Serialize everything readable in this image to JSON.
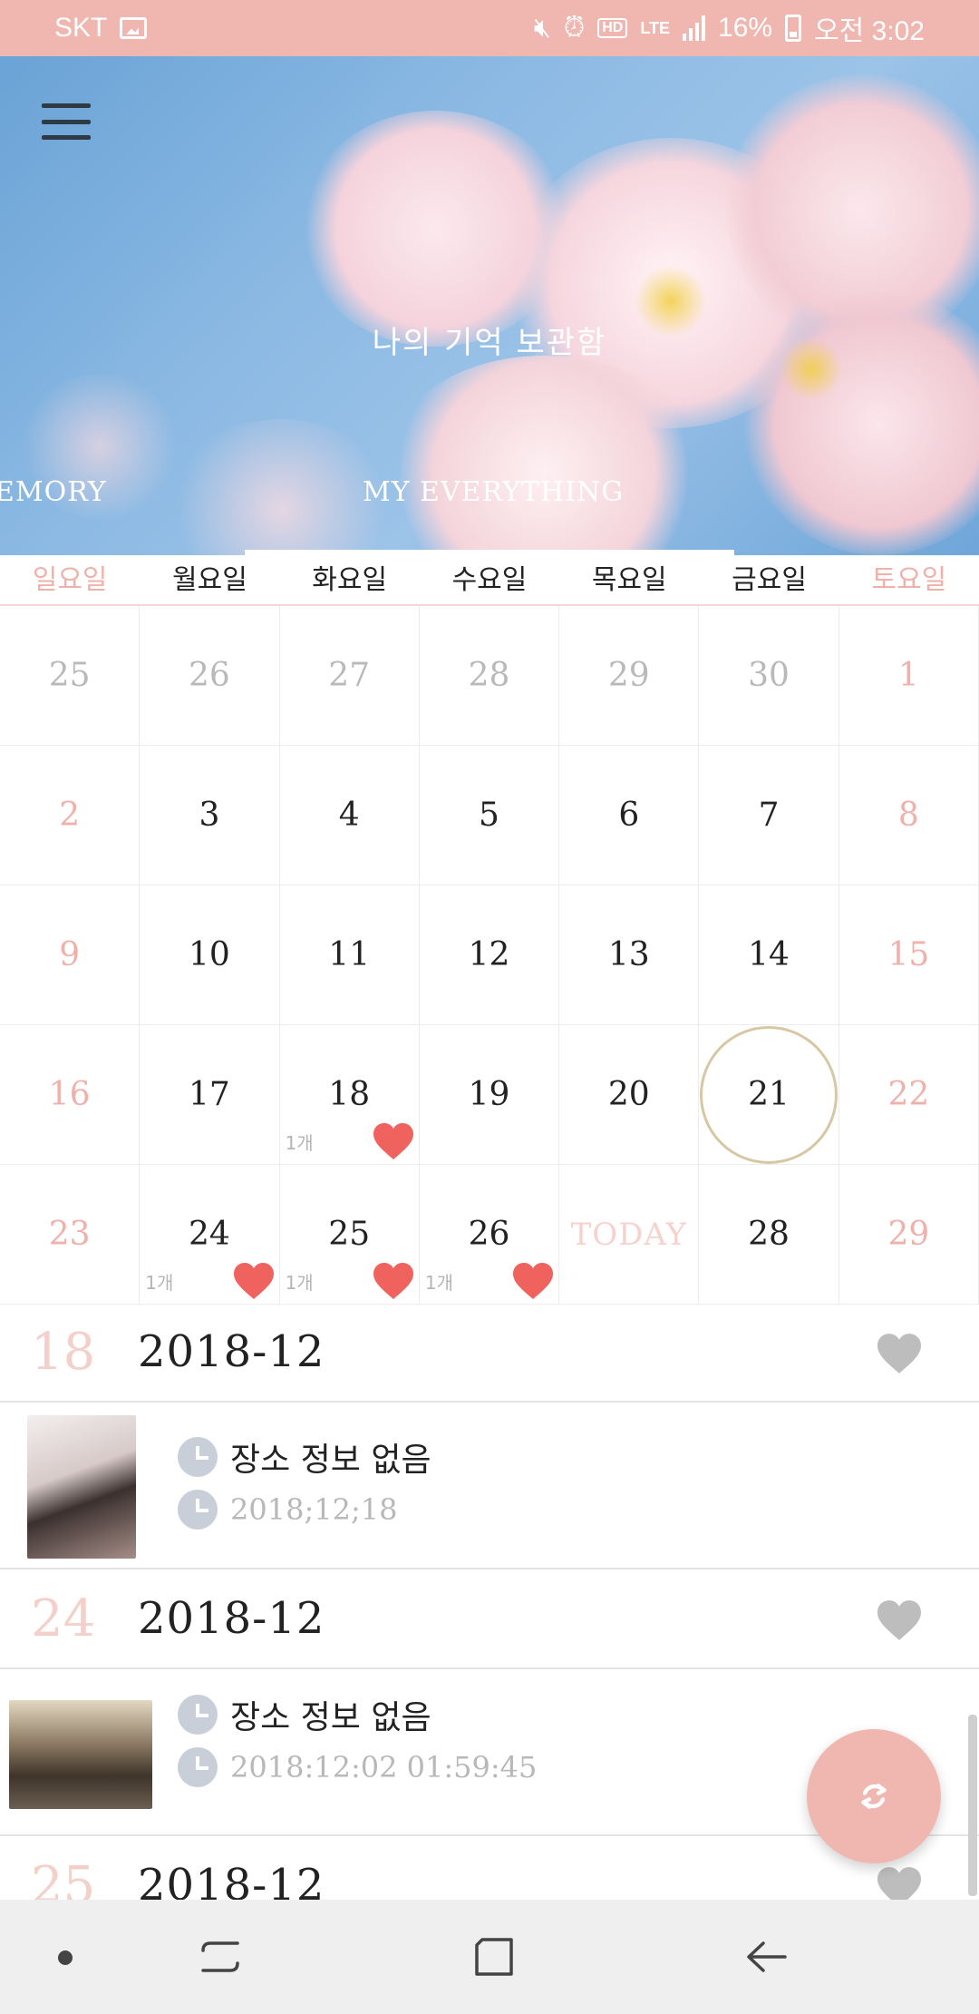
{
  "status_bar": {
    "carrier": "SKT",
    "network": "LTE",
    "hd_label": "HD",
    "battery": "16%",
    "time": "오전 3:02"
  },
  "header": {
    "title": "나의 기억 보관함",
    "tabs": [
      {
        "label": "EMORY"
      },
      {
        "label": "MY EVERYTHING"
      }
    ]
  },
  "calendar": {
    "weekdays": [
      "일요일",
      "월요일",
      "화요일",
      "수요일",
      "목요일",
      "금요일",
      "토요일"
    ],
    "weeks": [
      [
        "25",
        "26",
        "27",
        "28",
        "29",
        "30",
        "1"
      ],
      [
        "2",
        "3",
        "4",
        "5",
        "6",
        "7",
        "8"
      ],
      [
        "9",
        "10",
        "11",
        "12",
        "13",
        "14",
        "15"
      ],
      [
        "16",
        "17",
        "18",
        "19",
        "20",
        "21",
        "22"
      ],
      [
        "23",
        "24",
        "25",
        "26",
        "TODAY",
        "28",
        "29"
      ]
    ],
    "count_label": "1개",
    "selected_day": "21",
    "colors": {
      "weekend": "#f0b1aa",
      "heart": "#f0625e",
      "accent": "#f0b7b0",
      "selected_ring": "#d8c7a4"
    }
  },
  "entries": [
    {
      "day": "18",
      "year_month": "2018-12",
      "place": "장소 정보 없음",
      "time": "2018;12;18"
    },
    {
      "day": "24",
      "year_month": "2018-12",
      "place": "장소 정보 없음",
      "time": "2018:12:02 01:59:45"
    },
    {
      "day": "25",
      "year_month": "2018-12"
    }
  ]
}
